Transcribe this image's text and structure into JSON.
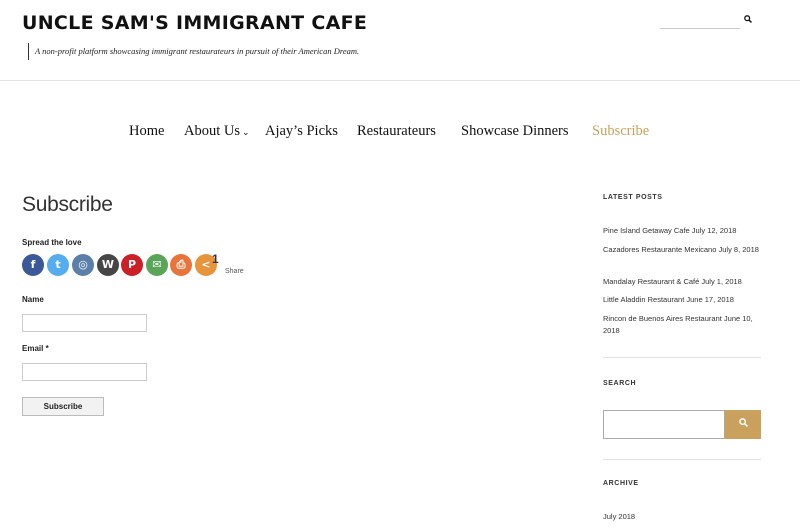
{
  "header": {
    "site_title": "UNCLE SAM'S IMMIGRANT CAFE",
    "tagline": "A non-profit platform showcasing immigrant restaurateurs in pursuit of their American Dream.",
    "search_icon": "search-icon"
  },
  "nav": {
    "items": [
      {
        "label": "Home"
      },
      {
        "label": "About Us"
      },
      {
        "label": "Ajay’s Picks"
      },
      {
        "label": "Restaurateurs"
      },
      {
        "label": "Showcase Dinners"
      },
      {
        "label": "Subscribe"
      }
    ],
    "dropdown_glyph": "⌄",
    "active_color": "#c9a15c"
  },
  "main": {
    "title": "Subscribe",
    "spread_label": "Spread the love",
    "share_buttons": [
      {
        "name": "facebook",
        "glyph": "f",
        "color": "#3b5998"
      },
      {
        "name": "twitter",
        "glyph": "t",
        "color": "#55acee"
      },
      {
        "name": "instagram",
        "glyph": "◎",
        "color": "#5b7fa8"
      },
      {
        "name": "wordpress",
        "glyph": "W",
        "color": "#464646"
      },
      {
        "name": "pinterest",
        "glyph": "P",
        "color": "#cb2027"
      },
      {
        "name": "email",
        "glyph": "✉",
        "color": "#5ba55a"
      },
      {
        "name": "print",
        "glyph": "⎙",
        "color": "#e8743b"
      },
      {
        "name": "more",
        "glyph": "<",
        "color": "#e8943b"
      }
    ],
    "share_count": "1",
    "share_label": "Share",
    "form": {
      "name_label": "Name",
      "email_label": "Email *",
      "submit_label": "Subscribe"
    }
  },
  "sidebar": {
    "latest_title": "LATEST POSTS",
    "posts": [
      {
        "text": "Pine Island Getaway Cafe July 12, 2018"
      },
      {
        "text": "Cazadores Restaurante Mexicano   July 8, 2018"
      },
      {
        "text": "Mandalay Restaurant & Café July 1, 2018"
      },
      {
        "text": "Little Aladdin Restaurant June 17, 2018"
      },
      {
        "text": "Rincon de Buenos Aires Restaurant June 10, 2018"
      }
    ],
    "search_title": "SEARCH",
    "archive_title": "ARCHIVE",
    "archive_items": [
      {
        "label": "July 2018"
      }
    ],
    "accent_color": "#c9a15c"
  }
}
